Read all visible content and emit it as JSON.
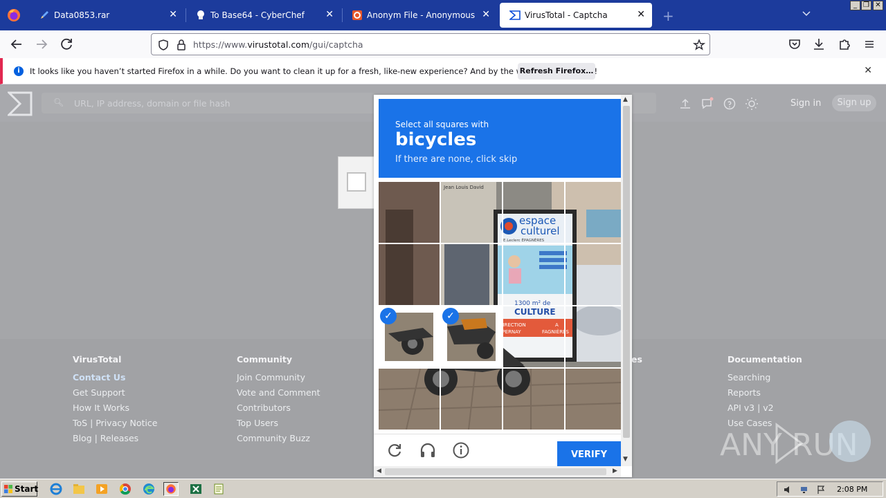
{
  "browser": {
    "tabs": [
      {
        "title": "Data0853.rar",
        "active": false
      },
      {
        "title": "To Base64 - CyberChef",
        "active": false
      },
      {
        "title": "Anonym File - Anonymous File Uplo",
        "active": false
      },
      {
        "title": "VirusTotal - Captcha",
        "active": true
      }
    ],
    "close_glyph": "✕",
    "new_tab_glyph": "+",
    "window_controls": [
      "_",
      "❐",
      "✕"
    ],
    "url_prefix": "https://www.",
    "url_domain": "virustotal.com",
    "url_path": "/gui/captcha"
  },
  "notification": {
    "message": "It looks like you haven’t started Firefox in a while. Do you want to clean it up for a fresh, like-new experience? And by the way, welcome back!",
    "button": "Refresh Firefox…"
  },
  "virustotal": {
    "search_placeholder": "URL, IP address, domain or file hash",
    "sign_in": "Sign in",
    "sign_up": "Sign up",
    "footer": [
      {
        "heading": "VirusTotal",
        "links": [
          "Contact Us",
          "Get Support",
          "How It Works",
          "ToS | Privacy Notice",
          "Blog | Releases"
        ]
      },
      {
        "heading": "Community",
        "links": [
          "Join Community",
          "Vote and Comment",
          "Contributors",
          "Top Users",
          "Community Buzz"
        ]
      },
      {
        "heading": "es",
        "links": []
      },
      {
        "heading": "Documentation",
        "links": [
          "Searching",
          "Reports",
          "API v3 | v2",
          "Use Cases"
        ]
      }
    ]
  },
  "captcha": {
    "instruction": "Select all squares with",
    "target": "bicycles",
    "hint": "If there are none, click skip",
    "verify": "VERIFY",
    "selected_tiles": [
      8,
      9
    ],
    "sign_text": [
      "espace",
      "culturel",
      "E.Leclerc ÉPAGNÈRES",
      "1300 m² de",
      "CULTURE",
      "DIRECTION",
      "A",
      "EPERNAY",
      "FAGNIÈRES"
    ],
    "storefront_text": "Jean Louis David"
  },
  "taskbar": {
    "start": "Start",
    "clock": "2:08 PM"
  },
  "watermark": "ANY RUN",
  "colors": {
    "firefox_tab_bg": "#1c3b9c",
    "captcha_blue": "#1a73e8",
    "notification_accent": "#e22850"
  }
}
